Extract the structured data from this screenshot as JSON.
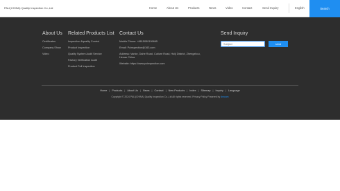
{
  "header": {
    "brand": "PALI(CHINA) Quality Inspection Co.,Ltd",
    "nav": [
      "Home",
      "About Us",
      "Products",
      "News",
      "Video",
      "Contact",
      "Send Inquiry"
    ],
    "language": "English",
    "search_label": "Search"
  },
  "footer": {
    "about": {
      "title": "About Us",
      "items": [
        "Certificates",
        "Company Show",
        "Video"
      ]
    },
    "products": {
      "title": "Related Products List",
      "items": [
        "Inspection &quality Control",
        "Product Inspection",
        "Quality System Audit Service",
        "Factory Verification Audit",
        "Product Full Inspection"
      ]
    },
    "contact": {
      "title": "Contact Us",
      "phone": "Mobile Phone: +8615050109665",
      "email": "Email: Pcinspection@163.com",
      "address_line1": "Address: Vanke, Dahe Road, Culture Road, Huiji District, Zhengzhou,",
      "address_line2": "Henan China",
      "website": "Website: https://www.pcinspection.com"
    },
    "inquiry": {
      "title": "Send Inquiry",
      "placeholder": "Subject",
      "send_label": "send"
    },
    "bottom_links": [
      "Home",
      "Products",
      "About Us",
      "News",
      "Contact",
      "New Products",
      "Index",
      "Sitemap",
      "Inquiry",
      "Language"
    ],
    "copyright": "Copyright © 2024 PALI(CHINA) Quality Inspection Co.,Ltd All rights reserved.  Privacy Policy  Powered by",
    "powered_by": "dmoom"
  }
}
